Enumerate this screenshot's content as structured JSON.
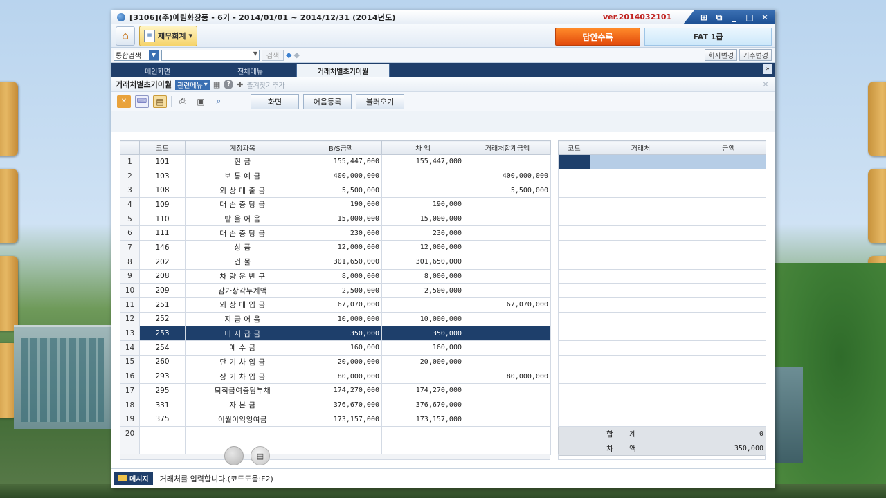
{
  "window": {
    "title": "[3106](주)예림화장품 - 6기 - 2014/01/01 ~ 2014/12/31 (2014년도)",
    "version": "ver.2014032101",
    "controls": [
      "⊞",
      "⧉",
      "_",
      "□",
      "✕"
    ]
  },
  "toolbar": {
    "module_label": "재무회계",
    "answer_button": "답안수록",
    "exam_level": "FAT 1급"
  },
  "search": {
    "type_label": "통합검색",
    "input_value": "",
    "search_button": "검색",
    "company_change": "회사변경",
    "period_change": "기수변경"
  },
  "tabs": [
    {
      "label": "메인화면"
    },
    {
      "label": "전체메뉴"
    },
    {
      "label": "거래처별초기이월"
    }
  ],
  "subbar": {
    "page_title": "거래처별초기이월",
    "related_menu": "관련메뉴",
    "add_favorite": "즐겨찾기추가"
  },
  "actions": {
    "screen": "화면",
    "note_register": "어음등록",
    "load": "불러오기"
  },
  "main_grid": {
    "headers": [
      "",
      "코드",
      "계정과목",
      "B/S금액",
      "차 액",
      "거래처합계금액"
    ],
    "rows": [
      {
        "n": "1",
        "code": "101",
        "name": "현 금",
        "bs": "155,447,000",
        "diff": "155,447,000",
        "total": ""
      },
      {
        "n": "2",
        "code": "103",
        "name": "보 통 예 금",
        "bs": "400,000,000",
        "diff": "",
        "total": "400,000,000"
      },
      {
        "n": "3",
        "code": "108",
        "name": "외 상 매 출 금",
        "bs": "5,500,000",
        "diff": "",
        "total": "5,500,000"
      },
      {
        "n": "4",
        "code": "109",
        "name": "대 손 충 당 금",
        "bs": "190,000",
        "diff": "190,000",
        "total": ""
      },
      {
        "n": "5",
        "code": "110",
        "name": "받 을 어 음",
        "bs": "15,000,000",
        "diff": "15,000,000",
        "total": ""
      },
      {
        "n": "6",
        "code": "111",
        "name": "대 손 충 당 금",
        "bs": "230,000",
        "diff": "230,000",
        "total": ""
      },
      {
        "n": "7",
        "code": "146",
        "name": "상 품",
        "bs": "12,000,000",
        "diff": "12,000,000",
        "total": ""
      },
      {
        "n": "8",
        "code": "202",
        "name": "건 물",
        "bs": "301,650,000",
        "diff": "301,650,000",
        "total": ""
      },
      {
        "n": "9",
        "code": "208",
        "name": "차 량 운 반 구",
        "bs": "8,000,000",
        "diff": "8,000,000",
        "total": ""
      },
      {
        "n": "10",
        "code": "209",
        "name": "감가상각누계액",
        "bs": "2,500,000",
        "diff": "2,500,000",
        "total": ""
      },
      {
        "n": "11",
        "code": "251",
        "name": "외 상 매 입 금",
        "bs": "67,070,000",
        "diff": "",
        "total": "67,070,000"
      },
      {
        "n": "12",
        "code": "252",
        "name": "지 급 어 음",
        "bs": "10,000,000",
        "diff": "10,000,000",
        "total": ""
      },
      {
        "n": "13",
        "code": "253",
        "name": "미 지 급 금",
        "bs": "350,000",
        "diff": "350,000",
        "total": "",
        "selected": true
      },
      {
        "n": "14",
        "code": "254",
        "name": "예 수 금",
        "bs": "160,000",
        "diff": "160,000",
        "total": ""
      },
      {
        "n": "15",
        "code": "260",
        "name": "단 기 차 입 금",
        "bs": "20,000,000",
        "diff": "20,000,000",
        "total": ""
      },
      {
        "n": "16",
        "code": "293",
        "name": "장 기 차 입 금",
        "bs": "80,000,000",
        "diff": "",
        "total": "80,000,000"
      },
      {
        "n": "17",
        "code": "295",
        "name": "퇴직급여충당부채",
        "bs": "174,270,000",
        "diff": "174,270,000",
        "total": ""
      },
      {
        "n": "18",
        "code": "331",
        "name": "자 본 금",
        "bs": "376,670,000",
        "diff": "376,670,000",
        "total": ""
      },
      {
        "n": "19",
        "code": "375",
        "name": "이월이익잉여금",
        "bs": "173,157,000",
        "diff": "173,157,000",
        "total": ""
      },
      {
        "n": "20",
        "code": "",
        "name": "",
        "bs": "",
        "diff": "",
        "total": ""
      },
      {
        "n": "",
        "code": "",
        "name": "",
        "bs": "",
        "diff": "",
        "total": ""
      }
    ]
  },
  "side_grid": {
    "headers": [
      "코드",
      "거래처",
      "금액"
    ],
    "sum_label": "합 계",
    "sum_value": "0",
    "diff_label": "차 액",
    "diff_value": "350,000"
  },
  "status": {
    "label": "메시지",
    "message": "거래처를 입력합니다.(코드도움:F2)"
  },
  "colors": {
    "nav_dark": "#1f3e6a",
    "selected_row": "#1e3f6b",
    "answer_button": "#e24a0c",
    "version_text": "#c0221f"
  }
}
